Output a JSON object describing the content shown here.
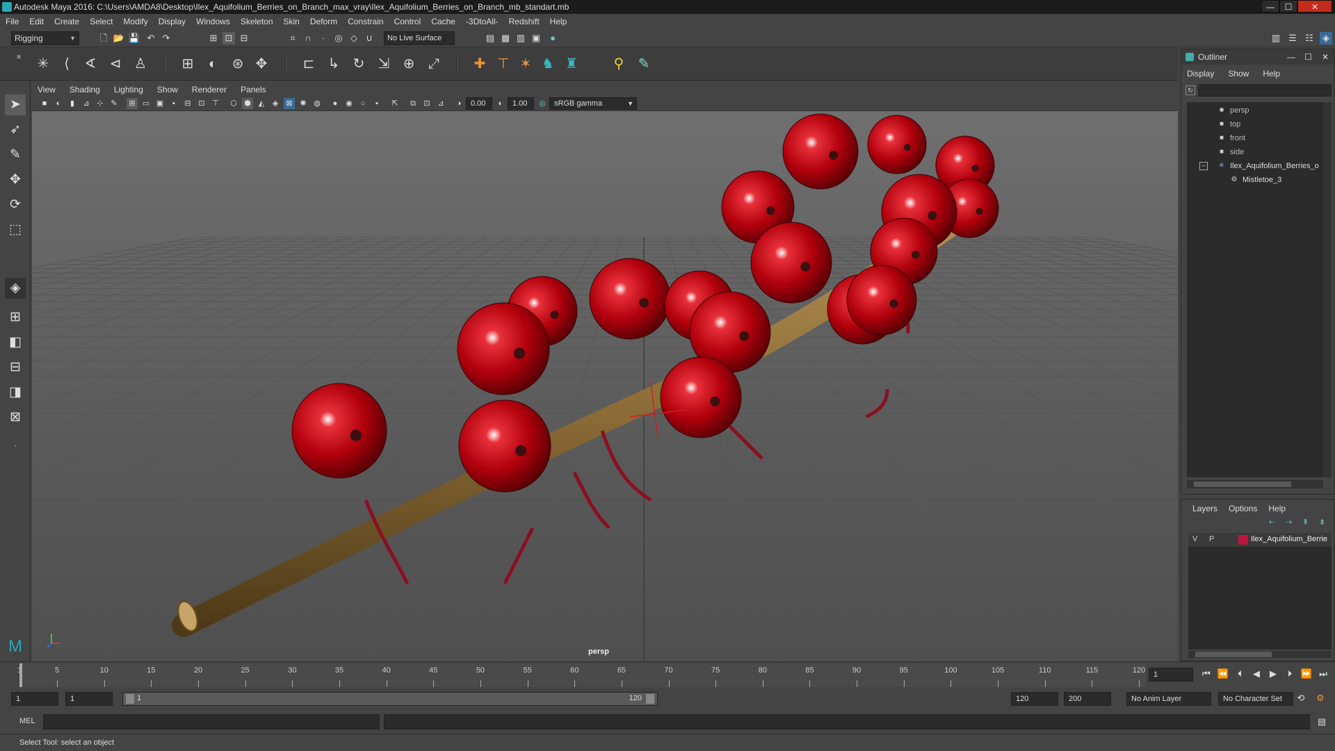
{
  "window": {
    "title": "Autodesk Maya 2016: C:\\Users\\AMDA8\\Desktop\\Ilex_Aquifolium_Berries_on_Branch_max_vray\\Ilex_Aquifolium_Berries_on_Branch_mb_standart.mb",
    "min": "—",
    "max": "☐",
    "close": "✕"
  },
  "menubar": [
    "File",
    "Edit",
    "Create",
    "Select",
    "Modify",
    "Display",
    "Windows",
    "Skeleton",
    "Skin",
    "Deform",
    "Constrain",
    "Control",
    "Cache",
    "-3DtoAll-",
    "Redshift",
    "Help"
  ],
  "statusline": {
    "mode": "Rigging",
    "live_surface": "No Live Surface"
  },
  "panel": {
    "menu": [
      "View",
      "Shading",
      "Lighting",
      "Show",
      "Renderer",
      "Panels"
    ],
    "exposure": "0.00",
    "gamma": "1.00",
    "color_space": "sRGB gamma",
    "camera_label": "persp"
  },
  "outliner": {
    "title": "Outliner",
    "menu": [
      "Display",
      "Show",
      "Help"
    ],
    "items": [
      {
        "label": "persp",
        "icon": "camera-icon"
      },
      {
        "label": "top",
        "icon": "camera-icon"
      },
      {
        "label": "front",
        "icon": "camera-icon"
      },
      {
        "label": "side",
        "icon": "camera-icon"
      },
      {
        "label": "Ilex_Aquifolium_Berries_o",
        "icon": "joint-icon"
      },
      {
        "label": "Mistletoe_3",
        "icon": "mesh-icon"
      }
    ],
    "expand": "−"
  },
  "layers": {
    "menu": [
      "Layers",
      "Options",
      "Help"
    ],
    "row": {
      "v": "V",
      "p": "P",
      "name": "Ilex_Aquifolium_Berrie",
      "color": "#c0143c"
    }
  },
  "timeline": {
    "ticks": [
      "1",
      "5",
      "10",
      "15",
      "20",
      "25",
      "30",
      "35",
      "40",
      "45",
      "50",
      "55",
      "60",
      "65",
      "70",
      "75",
      "80",
      "85",
      "90",
      "95",
      "100",
      "105",
      "110",
      "115",
      "120"
    ],
    "current_frame": "1"
  },
  "range": {
    "start": "1",
    "anim_start": "1",
    "range_start_label": "1",
    "range_end_label": "120",
    "anim_end": "120",
    "end": "200",
    "anim_layer": "No Anim Layer",
    "char_set": "No Character Set"
  },
  "command": {
    "label": "MEL"
  },
  "help": {
    "text": "Select Tool: select an object"
  },
  "colors": {
    "berry": "#b0000c",
    "branch": "#8a6a35"
  }
}
